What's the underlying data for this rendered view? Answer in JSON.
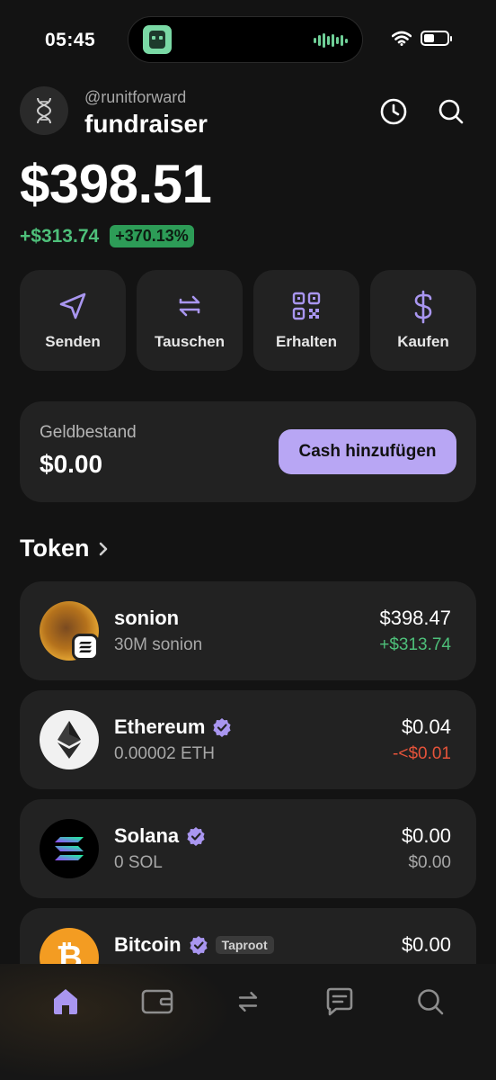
{
  "status_bar": {
    "time": "05:45"
  },
  "header": {
    "handle": "@runitforward",
    "account_name": "fundraiser"
  },
  "portfolio": {
    "balance": "$398.51",
    "change_abs": "+$313.74",
    "change_pct": "+370.13%"
  },
  "actions": [
    {
      "label": "Senden",
      "icon": "send-icon"
    },
    {
      "label": "Tauschen",
      "icon": "swap-icon"
    },
    {
      "label": "Erhalten",
      "icon": "qr-code-icon"
    },
    {
      "label": "Kaufen",
      "icon": "dollar-icon"
    }
  ],
  "cash": {
    "label": "Geldbestand",
    "value": "$0.00",
    "button_label": "Cash hinzufügen"
  },
  "tokens_section": {
    "title": "Token"
  },
  "tokens": [
    {
      "name": "sonion",
      "amount": "30M sonion",
      "value": "$398.47",
      "change": "+$313.74",
      "change_state": "positive",
      "verified": false
    },
    {
      "name": "Ethereum",
      "amount": "0.00002 ETH",
      "value": "$0.04",
      "change": "-<$0.01",
      "change_state": "negative",
      "verified": true
    },
    {
      "name": "Solana",
      "amount": "0 SOL",
      "value": "$0.00",
      "change": "$0.00",
      "change_state": "neutral",
      "verified": true
    },
    {
      "name": "Bitcoin",
      "tag": "Taproot",
      "value": "$0.00",
      "verified": true
    }
  ],
  "tabbar": [
    "home-icon",
    "wallet-icon",
    "swap-icon",
    "chat-icon",
    "search-icon"
  ],
  "colors": {
    "accent": "#b8a6f4",
    "positive": "#4ec07a",
    "negative": "#e5533a"
  }
}
